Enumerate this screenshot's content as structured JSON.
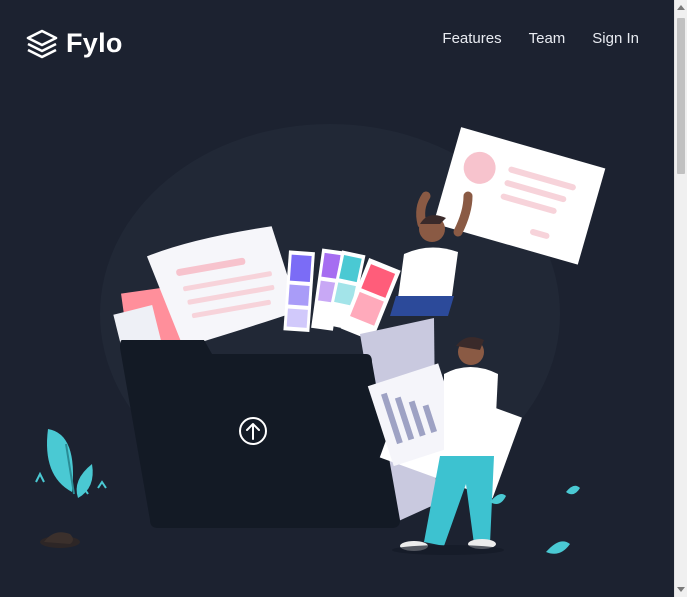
{
  "brand": {
    "name": "Fylo",
    "logo_icon": "stacked-layers-icon"
  },
  "nav": {
    "items": [
      {
        "label": "Features"
      },
      {
        "label": "Team"
      },
      {
        "label": "Sign In"
      }
    ]
  },
  "hero": {
    "illustration": "people-uploading-files-to-folder",
    "upload_icon": "upload-arrow-icon"
  },
  "colors": {
    "background": "#1c2230",
    "folder": "#131a25",
    "accent_cyan": "#4ac9d3",
    "accent_pink": "#f7c3cd"
  }
}
